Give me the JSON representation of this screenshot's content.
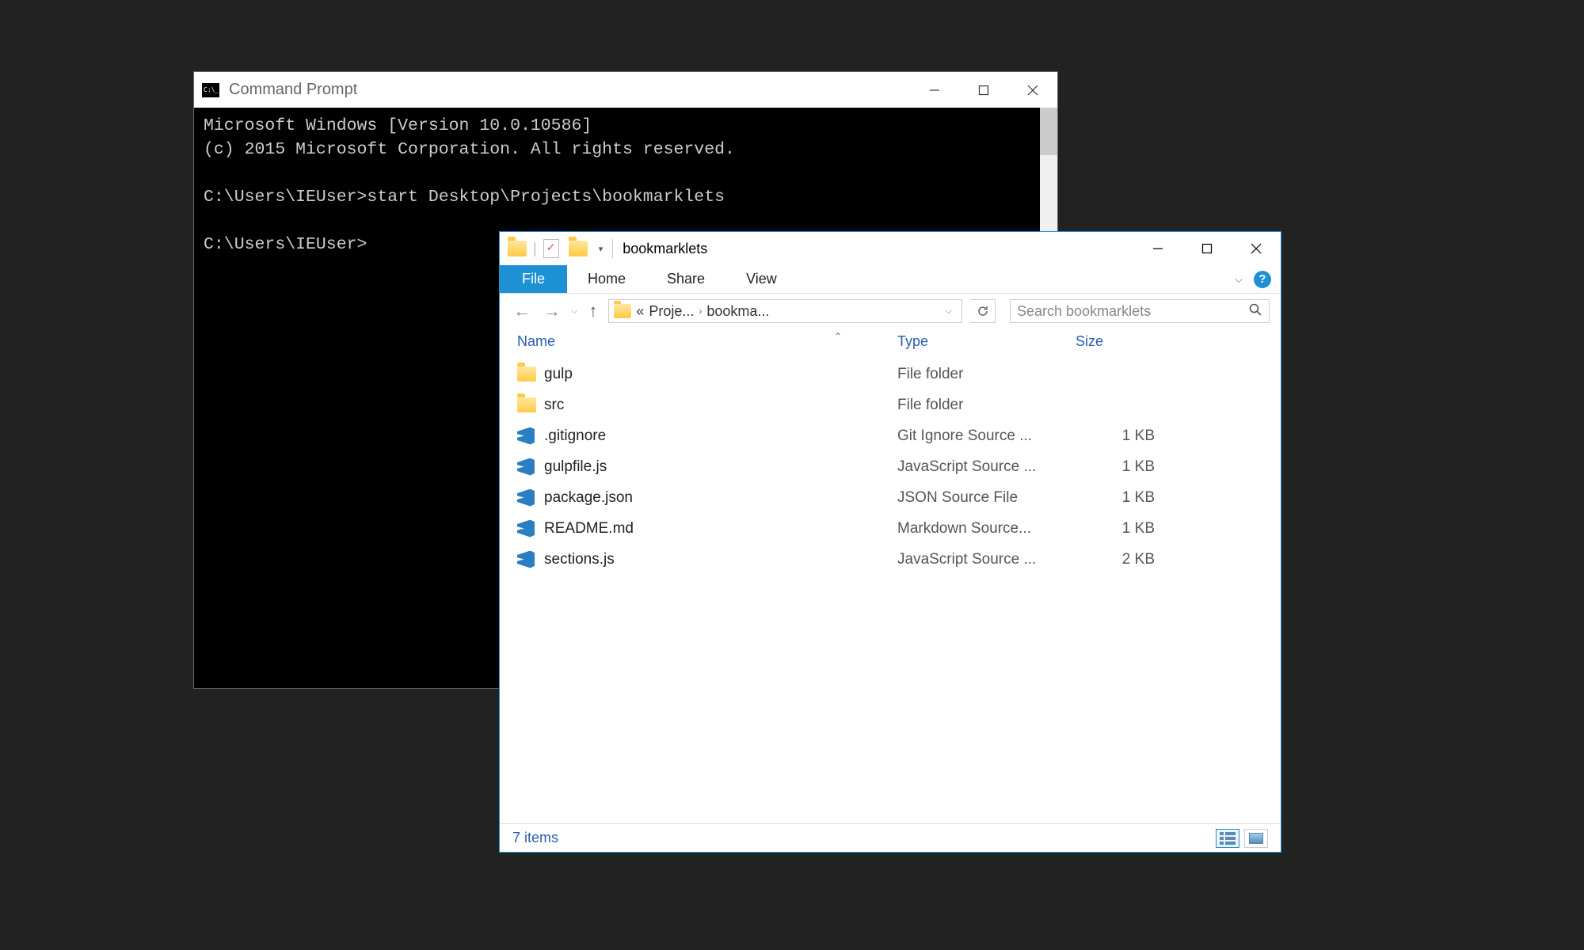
{
  "cmd": {
    "title": "Command Prompt",
    "lines": {
      "l1": "Microsoft Windows [Version 10.0.10586]",
      "l2": "(c) 2015 Microsoft Corporation. All rights reserved.",
      "blank1": "",
      "l3": "C:\\Users\\IEUser>start Desktop\\Projects\\bookmarklets",
      "blank2": "",
      "l4": "C:\\Users\\IEUser>"
    }
  },
  "explorer": {
    "title": "bookmarklets",
    "ribbon": {
      "file": "File",
      "home": "Home",
      "share": "Share",
      "view": "View"
    },
    "address": {
      "crumb1": "Proje...",
      "crumb2": "bookma...",
      "double_chevron": "«"
    },
    "search": {
      "placeholder": "Search bookmarklets"
    },
    "columns": {
      "name": "Name",
      "type": "Type",
      "size": "Size"
    },
    "files": [
      {
        "icon": "folder",
        "name": "gulp",
        "type": "File folder",
        "size": ""
      },
      {
        "icon": "folder",
        "name": "src",
        "type": "File folder",
        "size": ""
      },
      {
        "icon": "vscode",
        "name": ".gitignore",
        "type": "Git Ignore Source ...",
        "size": "1 KB"
      },
      {
        "icon": "vscode",
        "name": "gulpfile.js",
        "type": "JavaScript Source ...",
        "size": "1 KB"
      },
      {
        "icon": "vscode",
        "name": "package.json",
        "type": "JSON Source File",
        "size": "1 KB"
      },
      {
        "icon": "vscode",
        "name": "README.md",
        "type": "Markdown Source...",
        "size": "1 KB"
      },
      {
        "icon": "vscode",
        "name": "sections.js",
        "type": "JavaScript Source ...",
        "size": "2 KB"
      }
    ],
    "status": "7 items"
  }
}
